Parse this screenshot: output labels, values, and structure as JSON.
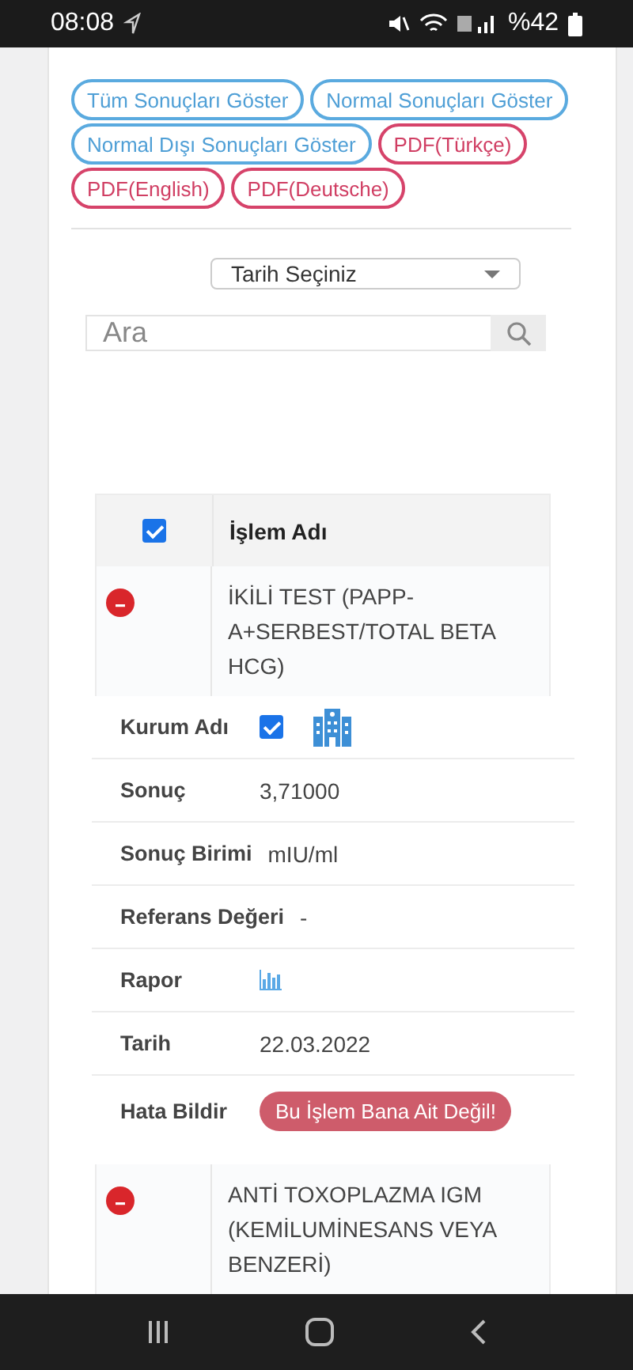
{
  "status_bar": {
    "time": "08:08",
    "battery": "%42"
  },
  "filters": [
    {
      "label": "Tüm Sonuçları Göster",
      "kind": "filter"
    },
    {
      "label": "Normal Sonuçları Göster",
      "kind": "filter"
    },
    {
      "label": "Normal Dışı Sonuçları Göster",
      "kind": "filter"
    },
    {
      "label": "PDF(Türkçe)",
      "kind": "pdf"
    },
    {
      "label": "PDF(English)",
      "kind": "pdf"
    },
    {
      "label": "PDF(Deutsche)",
      "kind": "pdf"
    }
  ],
  "date_select": {
    "value": "Tarih Seçiniz"
  },
  "search": {
    "placeholder": "Ara"
  },
  "table": {
    "select_all_checked": true,
    "column": "İşlem Adı",
    "rows": [
      {
        "name": "İKİLİ TEST (PAPP-A+SERBEST/TOTAL BETA HCG)",
        "details": [
          {
            "kind": "institution",
            "label": "Kurum Adı",
            "checked": true
          },
          {
            "kind": "text",
            "label": "Sonuç",
            "value": "3,71000"
          },
          {
            "kind": "text",
            "label": "Sonuç Birimi",
            "value": "mIU/ml"
          },
          {
            "kind": "text",
            "label": "Referans Değeri",
            "value": "-"
          },
          {
            "kind": "report",
            "label": "Rapor"
          },
          {
            "kind": "text",
            "label": "Tarih",
            "value": "22.03.2022"
          },
          {
            "kind": "button",
            "label": "Hata Bildir",
            "value": "Bu İşlem Bana Ait Değil!"
          }
        ]
      },
      {
        "name": "ANTİ TOXOPLAZMA IGM (KEMİLUMİNESANS VEYA BENZERİ)"
      }
    ]
  }
}
